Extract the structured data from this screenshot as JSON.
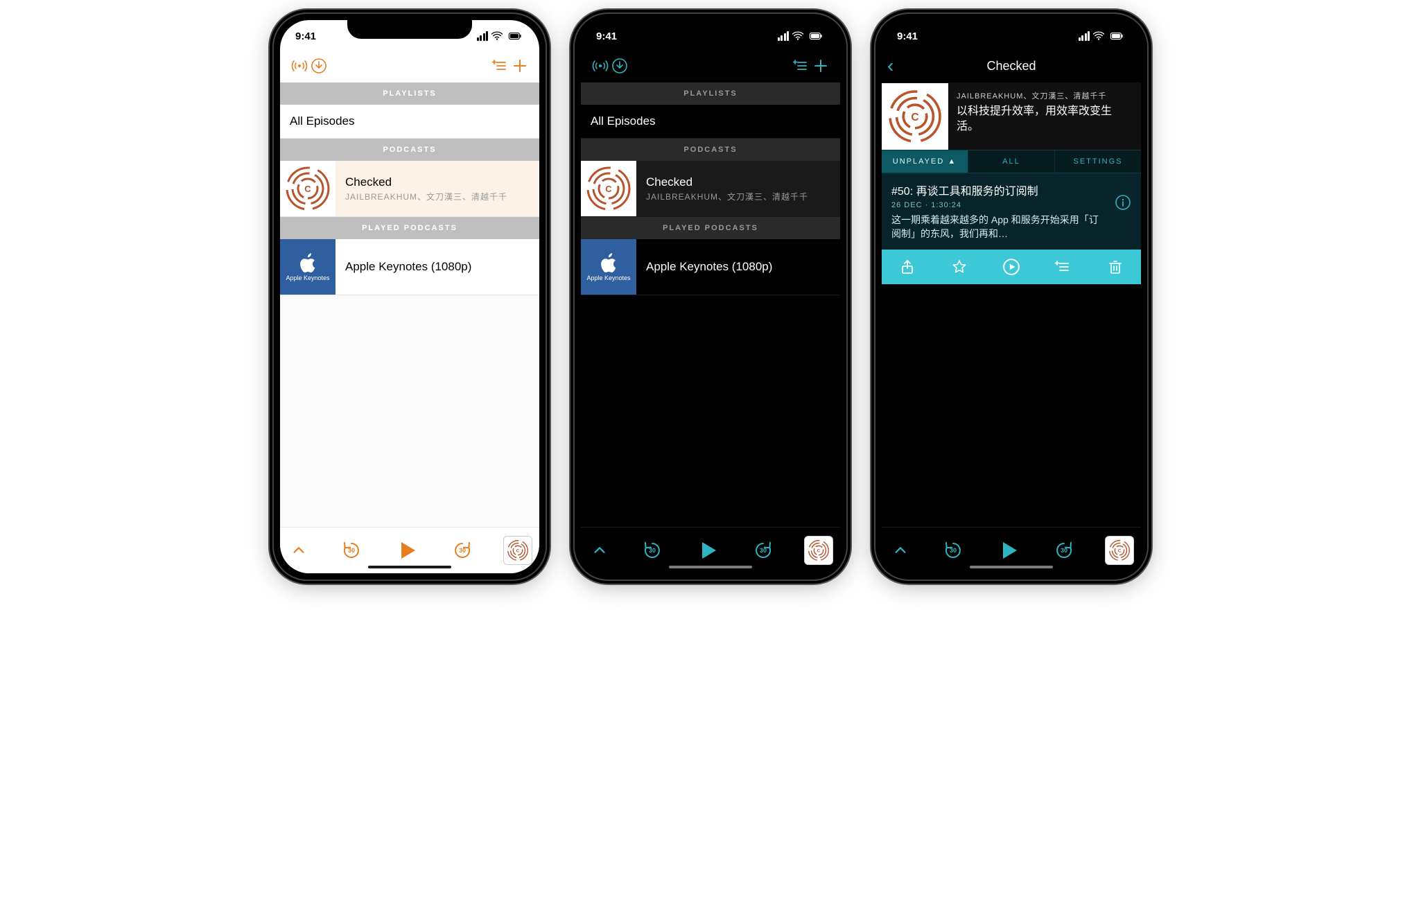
{
  "status": {
    "time": "9:41"
  },
  "colors": {
    "orange": "#e67e22",
    "teal": "#2fb4c2",
    "teal_bright": "#3cc8d6"
  },
  "list": {
    "sections": {
      "playlists": "PLAYLISTS",
      "podcasts": "PODCASTS",
      "played": "PLAYED PODCASTS"
    },
    "all_episodes": "All Episodes",
    "podcast": {
      "name": "Checked",
      "byline": "JAILBREAKHUM、文刀漢三、清越千千"
    },
    "played_podcast": {
      "name": "Apple Keynotes (1080p)",
      "art_label": "Apple Keynotes"
    }
  },
  "player": {
    "skip_seconds": "30"
  },
  "detail": {
    "nav_title": "Checked",
    "byline": "JAILBREAKHUM、文刀漢三、清越千千",
    "description": "以科技提升效率，用效率改变生活。",
    "tabs": {
      "unplayed": "UNPLAYED",
      "all": "ALL",
      "settings": "SETTINGS"
    },
    "episode": {
      "title": "#50: 再谈工具和服务的订阅制",
      "meta": "26 DEC · 1:30:24",
      "summary": "这一期乘着越来越多的 App 和服务开始采用「订阅制」的东风，我们再和…"
    }
  }
}
